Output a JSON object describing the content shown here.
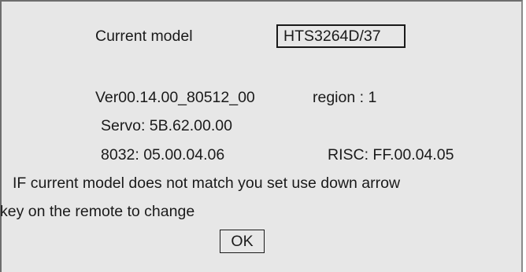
{
  "current_model": {
    "label": "Current model",
    "value": "HTS3264D/37"
  },
  "version": {
    "firmware": "Ver00.14.00_80512_00",
    "region": "region : 1",
    "servo": "Servo: 5B.62.00.00",
    "chip_8032": "8032: 05.00.04.06",
    "risc": "RISC: FF.00.04.05"
  },
  "instructions": {
    "line1": "IF current model does not match you set use down arrow",
    "line2": "key on the remote to change"
  },
  "ok_button": {
    "label": "OK"
  }
}
